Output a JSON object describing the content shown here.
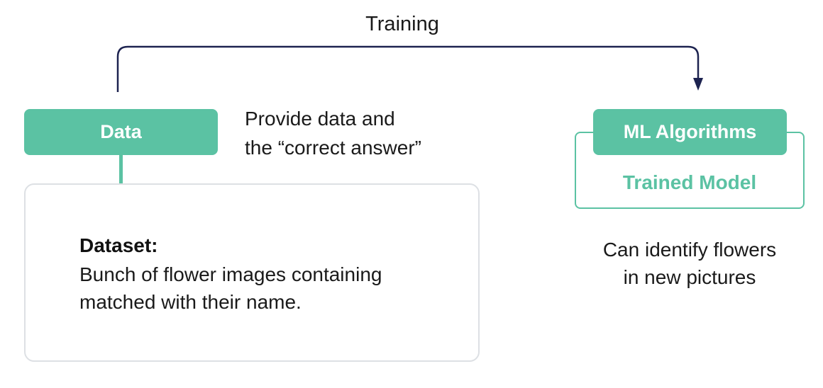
{
  "flow": {
    "training_label": "Training",
    "line_color": "#1d2350"
  },
  "data_node": {
    "label": "Data",
    "color": "#5bc2a3"
  },
  "provide_note": {
    "line1": "Provide data and",
    "line2": "the “correct answer”"
  },
  "dataset": {
    "heading": "Dataset:",
    "line1": "Bunch of flower images containing",
    "line2": "matched with their name."
  },
  "ml_node": {
    "label": "ML Algorithms",
    "model_label": "Trained Model",
    "color": "#5bc2a3"
  },
  "result_note": {
    "line1": "Can identify flowers",
    "line2": "in new pictures"
  }
}
